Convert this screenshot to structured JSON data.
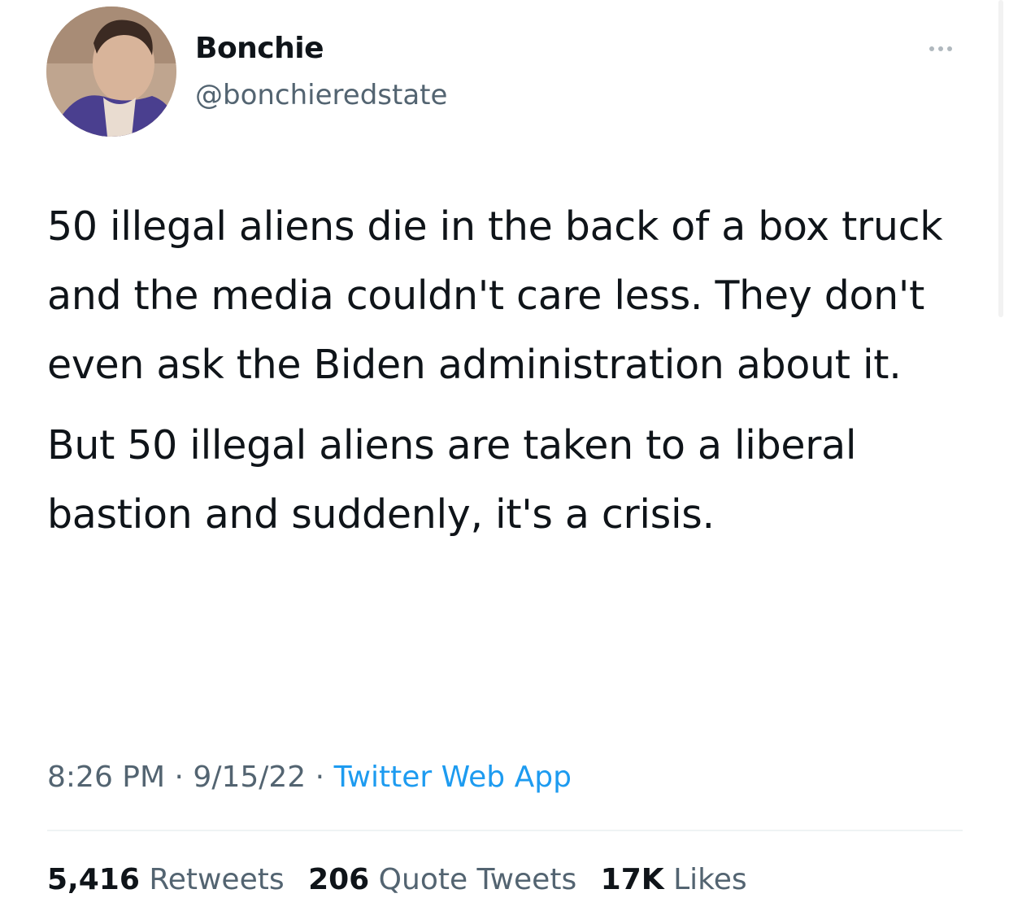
{
  "author": {
    "name": "Bonchie",
    "handle": "@bonchieredstate",
    "avatar_icon": "profile-photo"
  },
  "more_icon": "more-options-icon",
  "tweet": {
    "paragraphs": [
      "50 illegal aliens die in the back of a box truck and the media couldn't care less. They don't even ask the Biden administration about it.",
      "But 50 illegal aliens are taken to a liberal bastion and suddenly, it's a crisis."
    ],
    "time": "8:26 PM",
    "date": "9/15/22",
    "separator": "·",
    "source": "Twitter Web App"
  },
  "stats": {
    "retweets_count": "5,416",
    "retweets_label": "Retweets",
    "quotes_count": "206",
    "quotes_label": "Quote Tweets",
    "likes_count": "17K",
    "likes_label": "Likes"
  },
  "colors": {
    "text_primary": "#0f1419",
    "text_secondary": "#536471",
    "link": "#1d9bf0",
    "divider": "#eff3f4"
  }
}
